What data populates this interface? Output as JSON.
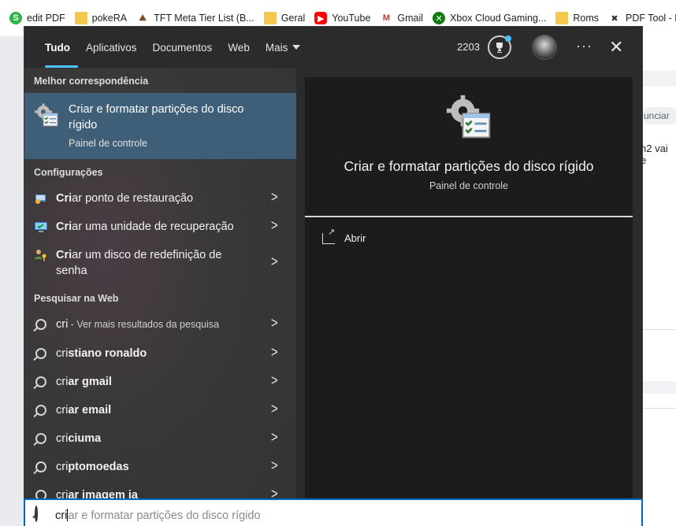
{
  "bookmarks": [
    {
      "label": "edit PDF",
      "icon": "s-circle-icon"
    },
    {
      "label": "pokeRA",
      "icon": "folder-icon"
    },
    {
      "label": "TFT Meta Tier List (B...",
      "icon": "tft-icon"
    },
    {
      "label": "Geral",
      "icon": "folder-icon"
    },
    {
      "label": "YouTube",
      "icon": "youtube-icon"
    },
    {
      "label": "Gmail",
      "icon": "gmail-icon"
    },
    {
      "label": "Xbox Cloud Gaming...",
      "icon": "xbox-icon"
    },
    {
      "label": "Roms",
      "icon": "folder-icon"
    },
    {
      "label": "PDF Tool - Ho",
      "icon": "tool-icon"
    }
  ],
  "background_page": {
    "pill_text": "unciar",
    "snippet": "n2 vai e"
  },
  "tabs": [
    {
      "label": "Tudo",
      "active": true
    },
    {
      "label": "Aplicativos"
    },
    {
      "label": "Documentos"
    },
    {
      "label": "Web"
    },
    {
      "label": "Mais"
    }
  ],
  "header": {
    "points": "2203",
    "more_label": "···",
    "close_label": "✕"
  },
  "best_match": {
    "heading": "Melhor correspondência",
    "title": "Criar e formatar partições do disco rígido",
    "subtitle": "Painel de controle"
  },
  "settings": {
    "heading": "Configurações",
    "items": [
      {
        "bold": "Cri",
        "rest": "ar ponto de restauração",
        "icon": "restore-point-icon"
      },
      {
        "bold": "Cri",
        "rest": "ar uma unidade de recuperação",
        "icon": "recovery-drive-icon"
      },
      {
        "bold": "Cri",
        "rest": "ar um disco de redefinição de senha",
        "icon": "password-reset-icon"
      }
    ]
  },
  "web": {
    "heading": "Pesquisar na Web",
    "items": [
      {
        "normal": "cri",
        "bold": "",
        "hint": " - Ver mais resultados da pesquisa"
      },
      {
        "normal": "cri",
        "bold": "stiano ronaldo",
        "hint": ""
      },
      {
        "normal": "cri",
        "bold": "ar gmail",
        "hint": ""
      },
      {
        "normal": "cri",
        "bold": "ar email",
        "hint": ""
      },
      {
        "normal": "cri",
        "bold": "ciuma",
        "hint": ""
      },
      {
        "normal": "cri",
        "bold": "ptomoedas",
        "hint": ""
      },
      {
        "normal": "cri",
        "bold": "ar imagem ia",
        "hint": ""
      }
    ]
  },
  "preview": {
    "title": "Criar e formatar partições do disco rígido",
    "subtitle": "Painel de controle",
    "action_label": "Abrir"
  },
  "search": {
    "typed": "cri",
    "completion": "ar e formatar partições do disco rígido"
  },
  "colors": {
    "accent": "#4cc2ff",
    "selected_row": "#3f5f78",
    "search_border": "#0067c0"
  }
}
